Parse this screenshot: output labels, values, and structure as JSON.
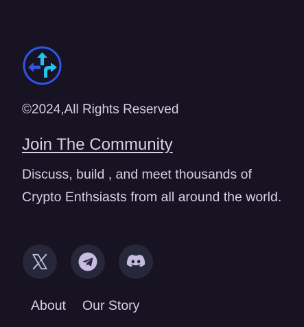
{
  "footer": {
    "logo_icon": "split-arrows-logo-icon",
    "copyright": "©2024,All Rights Reserved",
    "community_link": "Join The Community",
    "description": "Discuss, build , and meet thousands of Crypto Enthsiasts from all around the world.",
    "socials": [
      {
        "icon": "x-icon"
      },
      {
        "icon": "telegram-icon"
      },
      {
        "icon": "discord-icon"
      }
    ],
    "nav": [
      {
        "label": "About"
      },
      {
        "label": "Our Story"
      }
    ]
  },
  "colors": {
    "background": "#171322",
    "text": "#d9cfe8",
    "logo_blue": "#2f56e8",
    "logo_cyan": "#22c3ee",
    "social_bg": "#262738",
    "social_icon": "#c7bde0"
  }
}
